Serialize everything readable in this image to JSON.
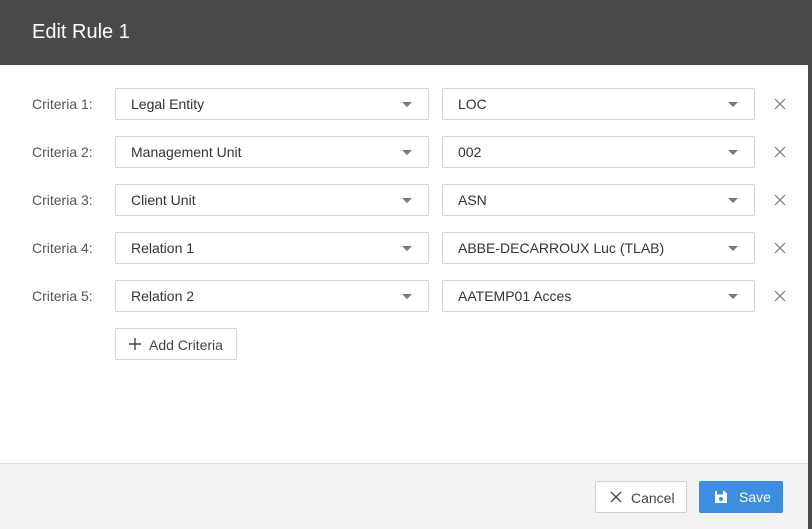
{
  "dialog": {
    "title": "Edit Rule 1",
    "header_color": "#4a4a4a"
  },
  "criteria": [
    {
      "label": "Criteria 1:",
      "field": "Legal Entity",
      "value": "LOC"
    },
    {
      "label": "Criteria 2:",
      "field": "Management Unit",
      "value": "002"
    },
    {
      "label": "Criteria 3:",
      "field": "Client Unit",
      "value": "ASN"
    },
    {
      "label": "Criteria 4:",
      "field": "Relation 1",
      "value": "ABBE-DECARROUX Luc (TLAB)"
    },
    {
      "label": "Criteria 5:",
      "field": "Relation 2",
      "value": "AATEMP01 Acces"
    }
  ],
  "icons": {
    "dropdown": "chevron-down-icon",
    "remove": "close-icon",
    "add": "plus-icon",
    "cancel": "close-icon",
    "save": "floppy-disk-icon"
  },
  "actions": {
    "add_criteria_label": "Add Criteria",
    "cancel_label": "Cancel",
    "save_label": "Save",
    "save_color": "#3d8ee0"
  }
}
